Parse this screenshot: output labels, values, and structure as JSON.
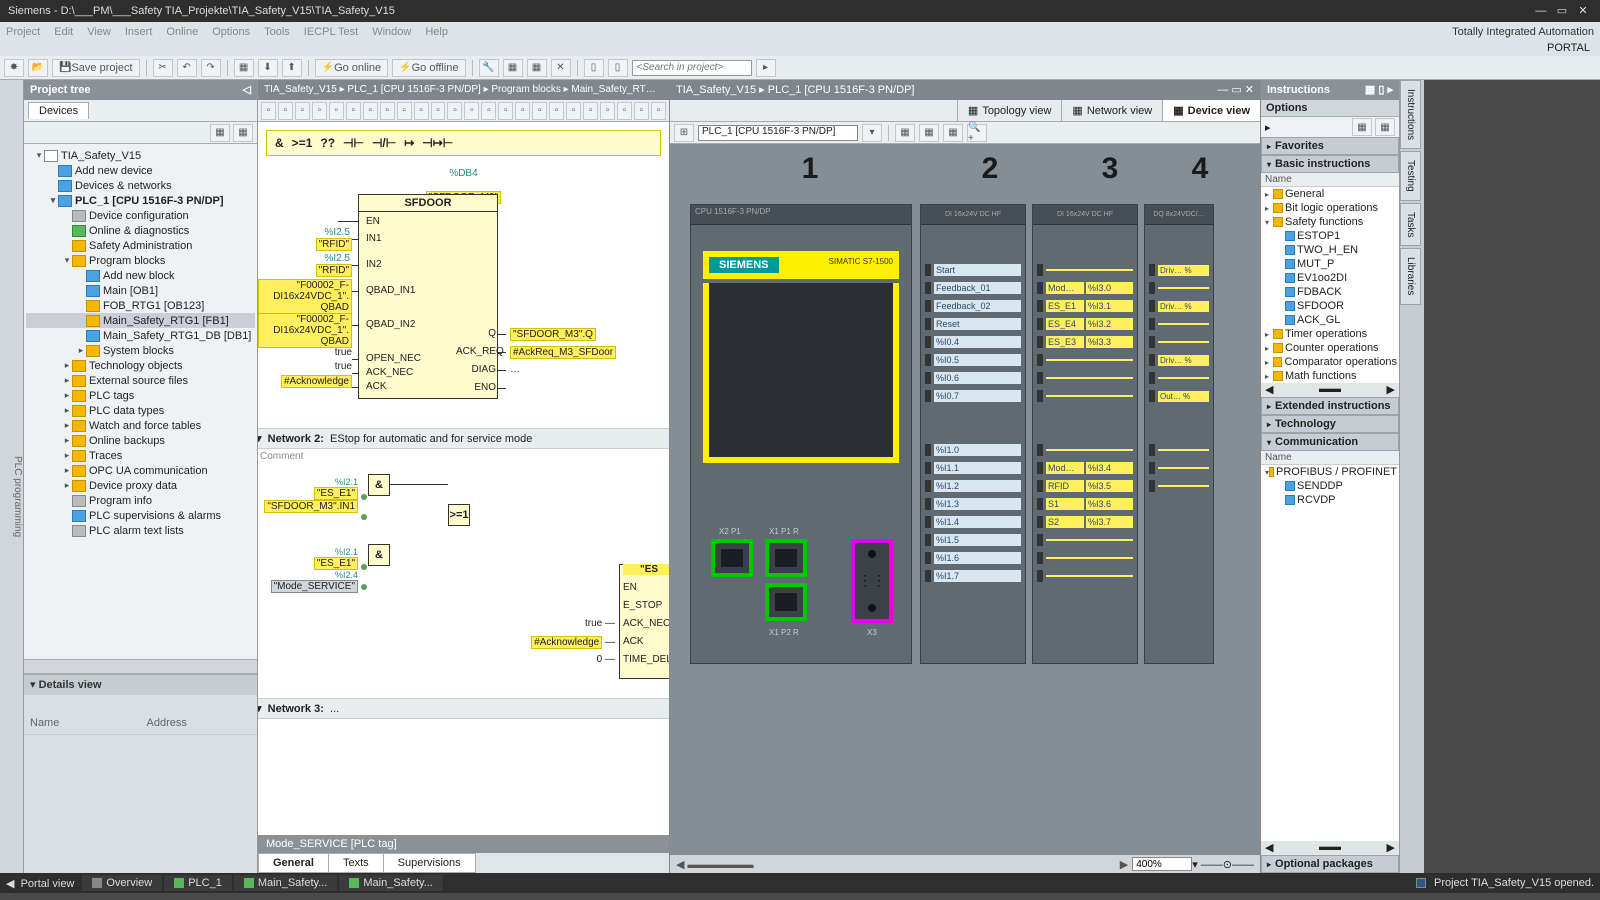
{
  "title": "Siemens  -  D:\\___PM\\___Safety TIA_Projekte\\TIA_Safety_V15\\TIA_Safety_V15",
  "menus": [
    "Project",
    "Edit",
    "View",
    "Insert",
    "Online",
    "Options",
    "Tools",
    "IECPL Test",
    "Window",
    "Help"
  ],
  "brand_line1": "Totally Integrated Automation",
  "brand_line2": "PORTAL",
  "toolbar": {
    "save": "Save project",
    "goonline": "Go online",
    "gooffline": "Go offline",
    "search_ph": "<Search in project>"
  },
  "side_rail": "PLC programming",
  "proj": {
    "hdr": "Project tree",
    "tab": "Devices",
    "tree": [
      {
        "d": 0,
        "tw": "▾",
        "ic": "wht",
        "t": "TIA_Safety_V15"
      },
      {
        "d": 1,
        "tw": "",
        "ic": "blue",
        "t": "Add new device"
      },
      {
        "d": 1,
        "tw": "",
        "ic": "blue",
        "t": "Devices & networks"
      },
      {
        "d": 1,
        "tw": "▾",
        "ic": "blue",
        "t": "PLC_1 [CPU 1516F-3 PN/DP]",
        "bold": true
      },
      {
        "d": 2,
        "tw": "",
        "ic": "gry",
        "t": "Device configuration"
      },
      {
        "d": 2,
        "tw": "",
        "ic": "grn",
        "t": "Online & diagnostics"
      },
      {
        "d": 2,
        "tw": "",
        "ic": "ylw",
        "t": "Safety Administration"
      },
      {
        "d": 2,
        "tw": "▾",
        "ic": "ylw",
        "t": "Program blocks"
      },
      {
        "d": 3,
        "tw": "",
        "ic": "blue",
        "t": "Add new block"
      },
      {
        "d": 3,
        "tw": "",
        "ic": "blue",
        "t": "Main [OB1]"
      },
      {
        "d": 3,
        "tw": "",
        "ic": "ylw",
        "t": "FOB_RTG1 [OB123]"
      },
      {
        "d": 3,
        "tw": "",
        "ic": "ylw",
        "t": "Main_Safety_RTG1 [FB1]",
        "sel": true
      },
      {
        "d": 3,
        "tw": "",
        "ic": "blue",
        "t": "Main_Safety_RTG1_DB [DB1]"
      },
      {
        "d": 3,
        "tw": "▸",
        "ic": "ylw",
        "t": "System blocks"
      },
      {
        "d": 2,
        "tw": "▸",
        "ic": "ylw",
        "t": "Technology objects"
      },
      {
        "d": 2,
        "tw": "▸",
        "ic": "ylw",
        "t": "External source files"
      },
      {
        "d": 2,
        "tw": "▸",
        "ic": "ylw",
        "t": "PLC tags"
      },
      {
        "d": 2,
        "tw": "▸",
        "ic": "ylw",
        "t": "PLC data types"
      },
      {
        "d": 2,
        "tw": "▸",
        "ic": "ylw",
        "t": "Watch and force tables"
      },
      {
        "d": 2,
        "tw": "▸",
        "ic": "ylw",
        "t": "Online backups"
      },
      {
        "d": 2,
        "tw": "▸",
        "ic": "ylw",
        "t": "Traces"
      },
      {
        "d": 2,
        "tw": "▸",
        "ic": "ylw",
        "t": "OPC UA communication"
      },
      {
        "d": 2,
        "tw": "▸",
        "ic": "ylw",
        "t": "Device proxy data"
      },
      {
        "d": 2,
        "tw": "",
        "ic": "gry",
        "t": "Program info"
      },
      {
        "d": 2,
        "tw": "",
        "ic": "blue",
        "t": "PLC supervisions & alarms"
      },
      {
        "d": 2,
        "tw": "",
        "ic": "gry",
        "t": "PLC alarm text lists"
      }
    ],
    "details_hdr": "Details view",
    "col1": "Name",
    "col2": "Address"
  },
  "ed1": {
    "crumb": "TIA_Safety_V15  ▸  PLC_1 [CPU 1516F-3 PN/DP]  ▸  Program blocks  ▸  Main_Safety_RT…",
    "ladbar": [
      "&",
      ">=1",
      "??",
      "⊣⊢",
      "⊣/⊢",
      "↦",
      "⊣↦⊢"
    ],
    "db": "%DB4",
    "dbname": "\"SFDOOR_M3\"",
    "fbname": "SFDOOR",
    "inputs": [
      {
        "addr": "%I2.5",
        "tag": "\"RFID\"",
        "pin": "IN1"
      },
      {
        "addr": "%I2.5",
        "tag": "\"RFID\"",
        "pin": "IN2"
      },
      {
        "addr": "",
        "tag": "\"F00002_F-DI16x24VDC_1\". QBAD",
        "pin": "QBAD_IN1"
      },
      {
        "addr": "",
        "tag": "\"F00002_F-DI16x24VDC_1\". QBAD",
        "pin": "QBAD_IN2"
      },
      {
        "addr": "",
        "tag": "true",
        "pin": "OPEN_NEC",
        "plain": true
      },
      {
        "addr": "",
        "tag": "true",
        "pin": "ACK_NEC",
        "plain": true
      },
      {
        "addr": "",
        "tag": "#Acknowledge",
        "pin": "ACK"
      }
    ],
    "en_pin": "EN",
    "outputs": [
      {
        "pin": "Q",
        "tag": "\"SFDOOR_M3\".Q"
      },
      {
        "pin": "ACK_REQ",
        "tag": "#AckReq_M3_SFDoor"
      },
      {
        "pin": "DIAG",
        "tag": "…",
        "plain": true
      },
      {
        "pin": "ENO",
        "tag": ""
      }
    ],
    "net2": "Network 2:",
    "net2t": "EStop for automatic and for service mode",
    "comment": "Comment",
    "n2_sig": [
      {
        "addr": "%I2.1",
        "tag": "\"ES_E1\""
      },
      {
        "addr": "",
        "tag": "\"SFDOOR_M3\".IN1"
      },
      {
        "addr": "%I2.1",
        "tag": "\"ES_E1\""
      },
      {
        "addr": "%I2.4",
        "tag": "\"Mode_SERVICE\"",
        "grey": true
      }
    ],
    "n2_fb": [
      "\"ES",
      "EN",
      "E_STOP",
      "ACK_NEC",
      "ACK",
      "TIME_DEL"
    ],
    "n2_vals": [
      "true",
      "#Acknowledge",
      "0"
    ],
    "gate_and": "&",
    "gate_or": ">=1",
    "net3": "Network 3:",
    "net3t": "...",
    "footer": "Mode_SERVICE [PLC tag]",
    "tabs": [
      "General",
      "Texts",
      "Supervisions"
    ]
  },
  "ed2": {
    "crumb": "TIA_Safety_V15  ▸  PLC_1 [CPU 1516F-3 PN/DP]",
    "vt": [
      "Topology view",
      "Network view",
      "Device view"
    ],
    "dd": "PLC_1 [CPU 1516F-3 PN/DP]",
    "slots": [
      "1",
      "2",
      "3",
      "4"
    ],
    "cpu_top": "CPU 1516F-3 PN/DP",
    "siemens": "SIEMENS",
    "simatic": "SIMATIC\nS7-1500",
    "ports": [
      "X2 P1",
      "X1 P1 R",
      "X1 P2 R",
      "X3"
    ],
    "io2top": "DI 16x24V DC HF",
    "io2": [
      "Start",
      "Feedback_01",
      "Feedback_02",
      "Reset",
      "%I0.4",
      "%I0.5",
      "%I0.6",
      "%I0.7"
    ],
    "io2b": [
      "%I1.0",
      "%I1.1",
      "%I1.2",
      "%I1.3",
      "%I1.4",
      "%I1.5",
      "%I1.6",
      "%I1.7"
    ],
    "io3top": "DI 16x24V DC HF",
    "io3": [
      [
        "Mod…",
        "%I3.0"
      ],
      [
        "ES_E1",
        "%I3.1"
      ],
      [
        "ES_E4",
        "%I3.2"
      ],
      [
        "ES_E3",
        "%I3.3"
      ]
    ],
    "io3b": [
      [
        "Mod…",
        "%I3.4"
      ],
      [
        "RFID",
        "%I3.5"
      ],
      [
        "S1",
        "%I3.6"
      ],
      [
        "S2",
        "%I3.7"
      ]
    ],
    "io4": [
      "Driv…  %",
      "",
      "Driv…  %",
      "",
      "",
      "Driv…  %",
      "",
      "Out…  %"
    ],
    "zoom": "400%"
  },
  "right": {
    "hdr": "Instructions",
    "opt": "Options",
    "sects": [
      "Favorites",
      "Basic instructions"
    ],
    "namehdr": "Name",
    "basic": [
      {
        "tw": "▸",
        "ic": "fld",
        "t": "General"
      },
      {
        "tw": "▸",
        "ic": "fld",
        "t": "Bit logic operations"
      },
      {
        "tw": "▾",
        "ic": "fld",
        "t": "Safety functions"
      },
      {
        "tw": "",
        "ic": "blk",
        "t": "ESTOP1",
        "d": 1
      },
      {
        "tw": "",
        "ic": "blk",
        "t": "TWO_H_EN",
        "d": 1
      },
      {
        "tw": "",
        "ic": "blk",
        "t": "MUT_P",
        "d": 1
      },
      {
        "tw": "",
        "ic": "blk",
        "t": "EV1oo2DI",
        "d": 1
      },
      {
        "tw": "",
        "ic": "blk",
        "t": "FDBACK",
        "d": 1
      },
      {
        "tw": "",
        "ic": "blk",
        "t": "SFDOOR",
        "d": 1
      },
      {
        "tw": "",
        "ic": "blk",
        "t": "ACK_GL",
        "d": 1
      },
      {
        "tw": "▸",
        "ic": "fld",
        "t": "Timer operations"
      },
      {
        "tw": "▸",
        "ic": "fld",
        "t": "Counter operations"
      },
      {
        "tw": "▸",
        "ic": "fld",
        "t": "Comparator operations"
      },
      {
        "tw": "▸",
        "ic": "fld",
        "t": "Math functions"
      }
    ],
    "sects2": [
      "Extended instructions",
      "Technology",
      "Communication"
    ],
    "comm": [
      {
        "tw": "▾",
        "ic": "fld",
        "t": "PROFIBUS / PROFINET"
      },
      {
        "tw": "",
        "ic": "blk",
        "t": "SENDDP",
        "d": 1
      },
      {
        "tw": "",
        "ic": "blk",
        "t": "RCVDP",
        "d": 1
      }
    ],
    "optpkg": "Optional packages"
  },
  "rtabs": [
    "Instructions",
    "Testing",
    "Tasks",
    "Libraries"
  ],
  "status": {
    "portal": "Portal view",
    "tasks": [
      "Overview",
      "PLC_1",
      "Main_Safety...",
      "Main_Safety..."
    ],
    "msg": "Project TIA_Safety_V15 opened."
  }
}
